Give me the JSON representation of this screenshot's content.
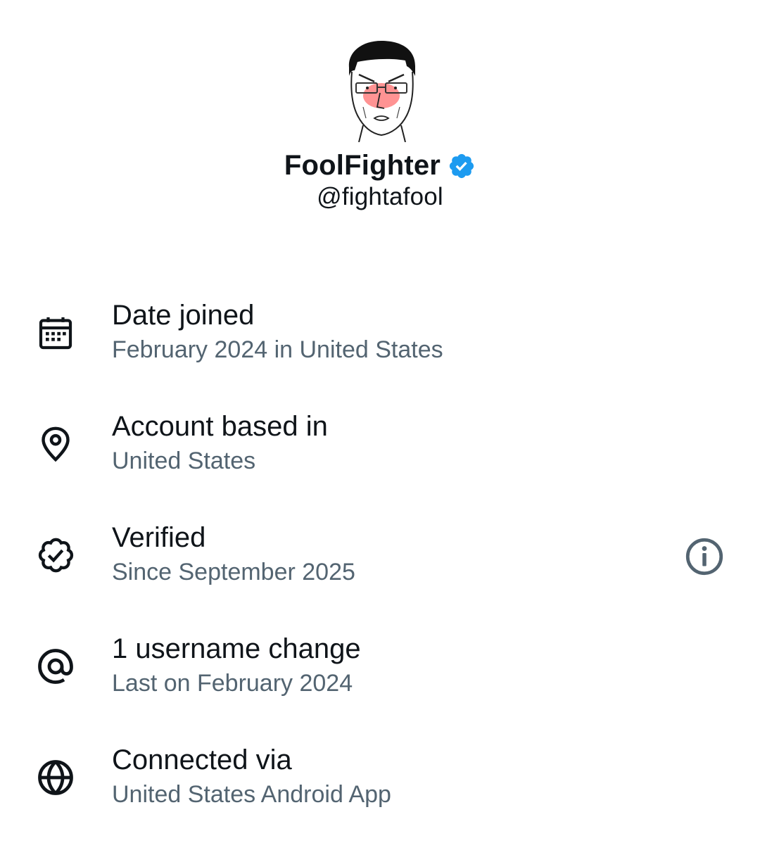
{
  "profile": {
    "display_name": "FoolFighter",
    "handle": "@fightafool",
    "verified": true,
    "badge_color": "#1d9bf0",
    "avatar_icon": "wojak-avatar"
  },
  "about_rows": [
    {
      "icon": "calendar-icon",
      "title": "Date joined",
      "subtitle": "February 2024 in United States"
    },
    {
      "icon": "location-pin-icon",
      "title": "Account based in",
      "subtitle": "United States"
    },
    {
      "icon": "verified-badge-icon",
      "title": "Verified",
      "subtitle": "Since September 2025",
      "has_info": true
    },
    {
      "icon": "at-sign-icon",
      "title": "1 username change",
      "subtitle": "Last on February 2024"
    },
    {
      "icon": "globe-icon",
      "title": "Connected via",
      "subtitle": "United States Android App"
    }
  ],
  "colors": {
    "primary_text": "#0f1419",
    "secondary_text": "#536471",
    "icon": "#0f1419",
    "info_icon": "#536471"
  }
}
